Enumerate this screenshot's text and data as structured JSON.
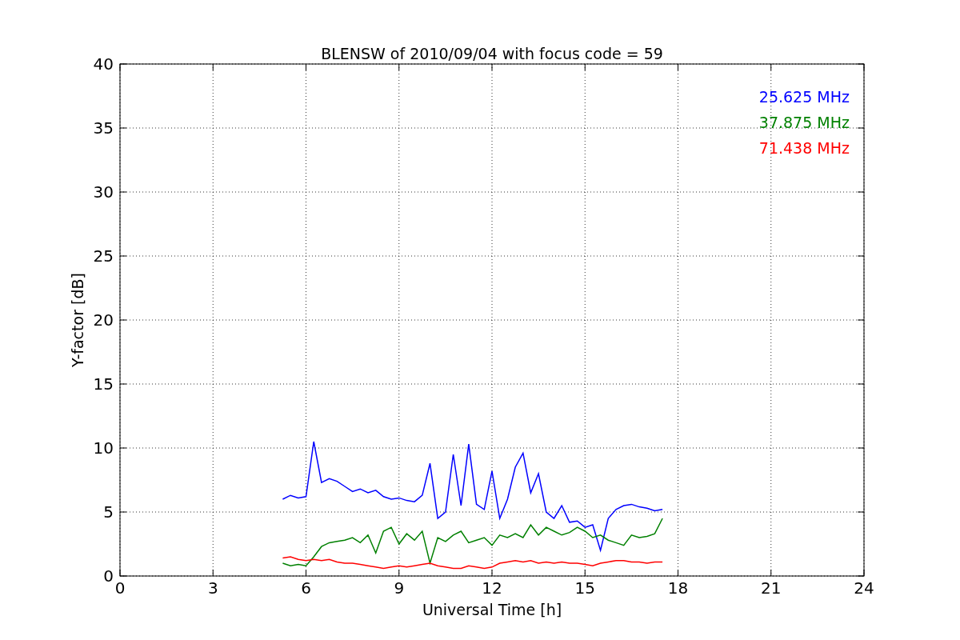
{
  "chart_data": {
    "type": "line",
    "title": "BLENSW of 2010/09/04 with focus code = 59",
    "xlabel": "Universal Time [h]",
    "ylabel": "Y-factor [dB]",
    "x": [
      5.25,
      5.5,
      5.75,
      6,
      6.25,
      6.5,
      6.75,
      7,
      7.25,
      7.5,
      7.75,
      8,
      8.25,
      8.5,
      8.75,
      9,
      9.25,
      9.5,
      9.75,
      10,
      10.25,
      10.5,
      10.75,
      11,
      11.25,
      11.5,
      11.75,
      12,
      12.25,
      12.5,
      12.75,
      13,
      13.25,
      13.5,
      13.75,
      14,
      14.25,
      14.5,
      14.75,
      15,
      15.25,
      15.5,
      15.75,
      16,
      16.25,
      16.5,
      16.75,
      17,
      17.25,
      17.5
    ],
    "series": [
      {
        "name": "25.625 MHz",
        "color": "#0000ff",
        "values": [
          6.0,
          6.3,
          6.1,
          6.2,
          10.5,
          7.3,
          7.6,
          7.4,
          7.0,
          6.6,
          6.8,
          6.5,
          6.7,
          6.2,
          6.0,
          6.1,
          5.9,
          5.8,
          6.3,
          8.8,
          4.5,
          5.0,
          9.5,
          5.5,
          10.3,
          5.6,
          5.2,
          8.2,
          4.5,
          6.0,
          8.5,
          9.6,
          6.5,
          8.0,
          5.0,
          4.5,
          5.5,
          4.2,
          4.3,
          3.8,
          4.0,
          2.0,
          4.5,
          5.2,
          5.5,
          5.6,
          5.4,
          5.3,
          5.1,
          5.2
        ]
      },
      {
        "name": "37.875 MHz",
        "color": "#008000",
        "values": [
          1.0,
          0.8,
          0.9,
          0.8,
          1.5,
          2.3,
          2.6,
          2.7,
          2.8,
          3.0,
          2.6,
          3.2,
          1.8,
          3.5,
          3.8,
          2.5,
          3.3,
          2.8,
          3.5,
          1.0,
          3.0,
          2.7,
          3.2,
          3.5,
          2.6,
          2.8,
          3.0,
          2.4,
          3.2,
          3.0,
          3.3,
          3.0,
          4.0,
          3.2,
          3.8,
          3.5,
          3.2,
          3.4,
          3.8,
          3.5,
          3.0,
          3.2,
          2.8,
          2.6,
          2.4,
          3.2,
          3.0,
          3.1,
          3.3,
          4.5
        ]
      },
      {
        "name": "71.438 MHz",
        "color": "#ff0000",
        "values": [
          1.4,
          1.5,
          1.3,
          1.2,
          1.3,
          1.2,
          1.3,
          1.1,
          1.0,
          1.0,
          0.9,
          0.8,
          0.7,
          0.6,
          0.7,
          0.8,
          0.7,
          0.8,
          0.9,
          1.0,
          0.8,
          0.7,
          0.6,
          0.6,
          0.8,
          0.7,
          0.6,
          0.7,
          1.0,
          1.1,
          1.2,
          1.1,
          1.2,
          1.0,
          1.1,
          1.0,
          1.1,
          1.0,
          1.0,
          0.9,
          0.8,
          1.0,
          1.1,
          1.2,
          1.2,
          1.1,
          1.1,
          1.0,
          1.1,
          1.1
        ]
      }
    ],
    "grid": true,
    "xlim": [
      0,
      24
    ],
    "ylim": [
      0,
      40
    ],
    "xticks": [
      0,
      3,
      6,
      9,
      12,
      15,
      18,
      21,
      24
    ],
    "yticks": [
      0,
      5,
      10,
      15,
      20,
      25,
      30,
      35,
      40
    ]
  }
}
